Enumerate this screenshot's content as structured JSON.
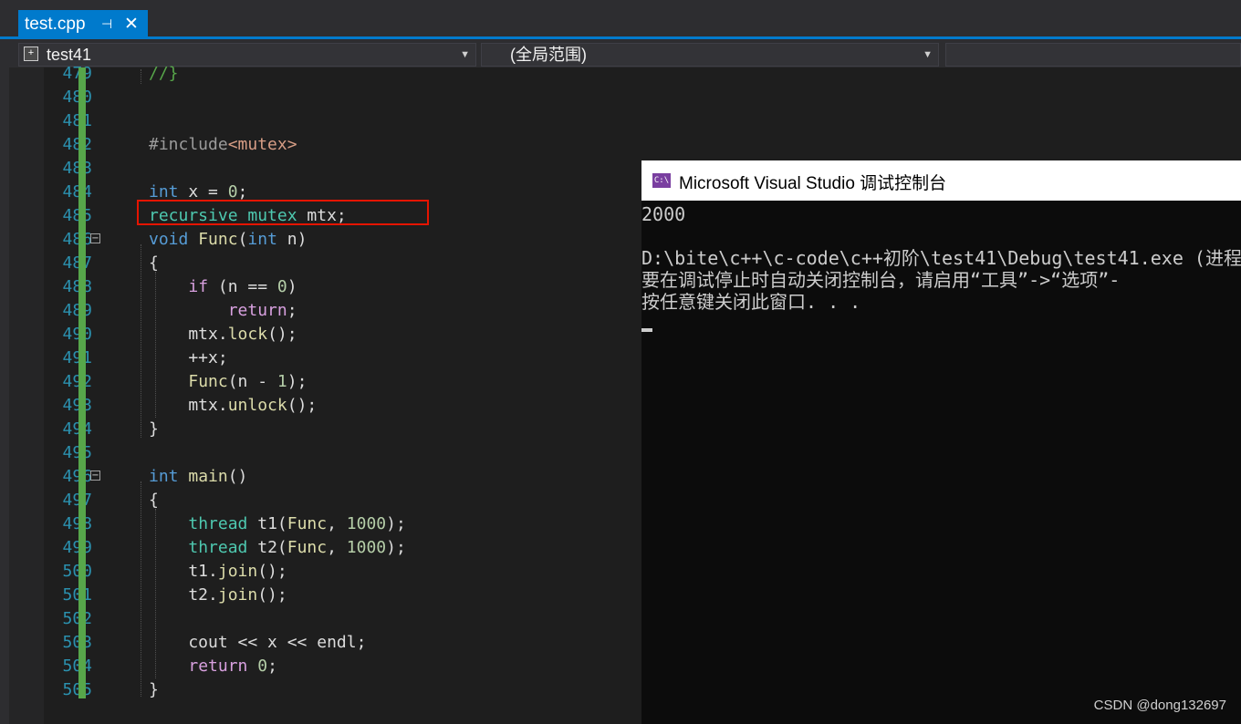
{
  "tab": {
    "title": "test.cpp",
    "pin_glyph": "⊣",
    "close_glyph": "✕"
  },
  "navbar": {
    "project": "test41",
    "scope": "(全局范围)"
  },
  "code": {
    "lines": [
      {
        "num": "479",
        "segments": [
          {
            "t": "//}",
            "c": "cm"
          }
        ]
      },
      {
        "num": "480",
        "segments": []
      },
      {
        "num": "481",
        "segments": []
      },
      {
        "num": "482",
        "segments": [
          {
            "t": "#include",
            "c": "pp"
          },
          {
            "t": "<mutex>",
            "c": "inc"
          }
        ]
      },
      {
        "num": "483",
        "segments": []
      },
      {
        "num": "484",
        "segments": [
          {
            "t": "int",
            "c": "kw"
          },
          {
            "t": " x = ",
            "c": ""
          },
          {
            "t": "0",
            "c": "nm"
          },
          {
            "t": ";",
            "c": ""
          }
        ]
      },
      {
        "num": "485",
        "segments": [
          {
            "t": "recursive_mutex",
            "c": "ty"
          },
          {
            "t": " mtx;",
            "c": ""
          }
        ]
      },
      {
        "num": "486",
        "segments": [
          {
            "t": "void",
            "c": "kw"
          },
          {
            "t": " ",
            "c": ""
          },
          {
            "t": "Func",
            "c": "fn"
          },
          {
            "t": "(",
            "c": ""
          },
          {
            "t": "int",
            "c": "kw"
          },
          {
            "t": " n)",
            "c": ""
          }
        ]
      },
      {
        "num": "487",
        "segments": [
          {
            "t": "{",
            "c": ""
          }
        ]
      },
      {
        "num": "488",
        "segments": [
          {
            "t": "    ",
            "c": ""
          },
          {
            "t": "if",
            "c": "kw2"
          },
          {
            "t": " (n == ",
            "c": ""
          },
          {
            "t": "0",
            "c": "nm"
          },
          {
            "t": ")",
            "c": ""
          }
        ]
      },
      {
        "num": "489",
        "segments": [
          {
            "t": "        ",
            "c": ""
          },
          {
            "t": "return",
            "c": "kw2"
          },
          {
            "t": ";",
            "c": ""
          }
        ]
      },
      {
        "num": "490",
        "segments": [
          {
            "t": "    mtx.",
            "c": ""
          },
          {
            "t": "lock",
            "c": "fn"
          },
          {
            "t": "();",
            "c": ""
          }
        ]
      },
      {
        "num": "491",
        "segments": [
          {
            "t": "    ++x;",
            "c": ""
          }
        ]
      },
      {
        "num": "492",
        "segments": [
          {
            "t": "    ",
            "c": ""
          },
          {
            "t": "Func",
            "c": "fn"
          },
          {
            "t": "(n - ",
            "c": ""
          },
          {
            "t": "1",
            "c": "nm"
          },
          {
            "t": ");",
            "c": ""
          }
        ]
      },
      {
        "num": "493",
        "segments": [
          {
            "t": "    mtx.",
            "c": ""
          },
          {
            "t": "unlock",
            "c": "fn"
          },
          {
            "t": "();",
            "c": ""
          }
        ]
      },
      {
        "num": "494",
        "segments": [
          {
            "t": "}",
            "c": ""
          }
        ]
      },
      {
        "num": "495",
        "segments": []
      },
      {
        "num": "496",
        "segments": [
          {
            "t": "int",
            "c": "kw"
          },
          {
            "t": " ",
            "c": ""
          },
          {
            "t": "main",
            "c": "fn"
          },
          {
            "t": "()",
            "c": ""
          }
        ]
      },
      {
        "num": "497",
        "segments": [
          {
            "t": "{",
            "c": ""
          }
        ]
      },
      {
        "num": "498",
        "segments": [
          {
            "t": "    ",
            "c": ""
          },
          {
            "t": "thread",
            "c": "ty"
          },
          {
            "t": " t1(",
            "c": ""
          },
          {
            "t": "Func",
            "c": "fn"
          },
          {
            "t": ", ",
            "c": ""
          },
          {
            "t": "1000",
            "c": "nm"
          },
          {
            "t": ");",
            "c": ""
          }
        ]
      },
      {
        "num": "499",
        "segments": [
          {
            "t": "    ",
            "c": ""
          },
          {
            "t": "thread",
            "c": "ty"
          },
          {
            "t": " t2(",
            "c": ""
          },
          {
            "t": "Func",
            "c": "fn"
          },
          {
            "t": ", ",
            "c": ""
          },
          {
            "t": "1000",
            "c": "nm"
          },
          {
            "t": ");",
            "c": ""
          }
        ]
      },
      {
        "num": "500",
        "segments": [
          {
            "t": "    t1.",
            "c": ""
          },
          {
            "t": "join",
            "c": "fn"
          },
          {
            "t": "();",
            "c": ""
          }
        ]
      },
      {
        "num": "501",
        "segments": [
          {
            "t": "    t2.",
            "c": ""
          },
          {
            "t": "join",
            "c": "fn"
          },
          {
            "t": "();",
            "c": ""
          }
        ]
      },
      {
        "num": "502",
        "segments": []
      },
      {
        "num": "503",
        "segments": [
          {
            "t": "    cout << x << endl;",
            "c": ""
          }
        ]
      },
      {
        "num": "504",
        "segments": [
          {
            "t": "    ",
            "c": ""
          },
          {
            "t": "return",
            "c": "kw2"
          },
          {
            "t": " ",
            "c": ""
          },
          {
            "t": "0",
            "c": "nm"
          },
          {
            "t": ";",
            "c": ""
          }
        ]
      },
      {
        "num": "505",
        "segments": [
          {
            "t": "}",
            "c": ""
          }
        ]
      }
    ]
  },
  "console": {
    "icon_text": "C:\\",
    "title": "Microsoft Visual Studio 调试控制台",
    "output": [
      "2000",
      "",
      "D:\\bite\\c++\\c-code\\c++初阶\\test41\\Debug\\test41.exe (进程",
      "要在调试停止时自动关闭控制台，请启用“工具”->“选项”-",
      "按任意键关闭此窗口. . ."
    ]
  },
  "watermark": "CSDN @dong132697"
}
